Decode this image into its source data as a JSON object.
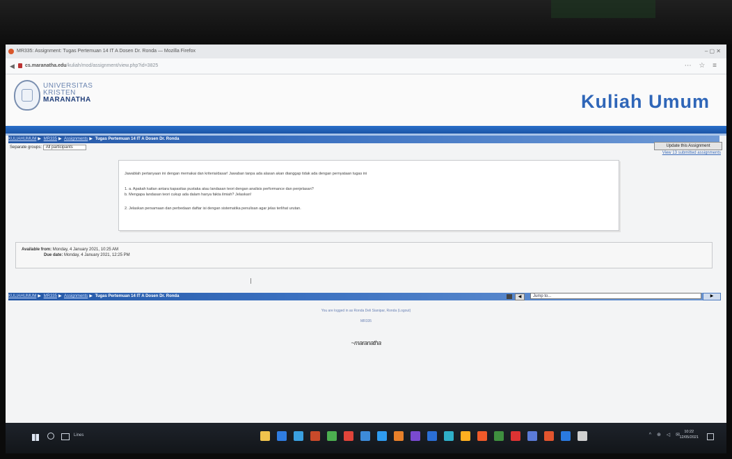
{
  "window": {
    "title": "MR335: Assignment: Tugas Pertemuan 14 IT A Dosen Dr. Ronda — Mozilla Firefox",
    "url_domain": "cs.maranatha.edu",
    "url_path": "/kuliah/mod/assignment/view.php?id=3825",
    "window_controls": "–   ▢   ✕"
  },
  "site": {
    "logo_line1": "UNIVERSITAS",
    "logo_line2": "KRISTEN",
    "logo_line3": "MARANATHA",
    "title": "Kuliah Umum"
  },
  "breadcrumb": {
    "items": [
      "KULIAHUMUM",
      "MR335",
      "Assignments"
    ],
    "current": "Tugas Pertemuan 14 IT A Dosen Dr. Ronda"
  },
  "group": {
    "label": "Separate groups",
    "selected": "All participants"
  },
  "actions": {
    "update_label": "Update this Assignment",
    "view_label": "View 13 submitted assignments"
  },
  "description": {
    "p1": "Jawablah pertanyaan ini dengan memakai dan kriteria/dasar! Jawaban tanpa ada alasan akan dianggap tidak ada dengan pernyataan tugas ini",
    "p2": "1. a. Apakah kaitan antara kapasitas pustaka atau landasan teori dengan analisis performance dan penjelasan?",
    "p3": "b. Mengapa landasan teori cukup ada dalam hanya fakta ilmiah? Jelaskan!",
    "p4": "2. Jelaskan persamaan dan perbedaan daftar isi dengan sistematika penulisan agar jelas terlihat urutan."
  },
  "dates": {
    "available_label": "Available from:",
    "available_value": "Monday, 4 January 2021, 10:25 AM",
    "due_label": "Due date:",
    "due_value": "Monday, 4 January 2021, 12:25 PM"
  },
  "jump": {
    "prev": "◀",
    "placeholder": "Jump to...",
    "next": "▶"
  },
  "footer": {
    "logged_in": "You are logged in as Ronda Deli Sianipar, Ronda (Logout)",
    "home": "MR335",
    "logo": "~maranatha"
  },
  "taskbar": {
    "search_hint": "Lines",
    "tray": "^ ⊕ ◁ ✉",
    "time": "10:22",
    "date": "12/05/2021",
    "app_colors": [
      "#f0c34d",
      "#2f7de1",
      "#3aa0e0",
      "#c94a2a",
      "#4caf50",
      "#e0443a",
      "#3d8bd9",
      "#2f9cf0",
      "#e8802a",
      "#7a4ad0",
      "#2b6fd6",
      "#2fb0c9",
      "#ffb020",
      "#ef5a2a",
      "#3f8f3f",
      "#d33",
      "#5b7bd8",
      "#e2552e",
      "#2a7ae0",
      "#d0d0d0"
    ]
  }
}
